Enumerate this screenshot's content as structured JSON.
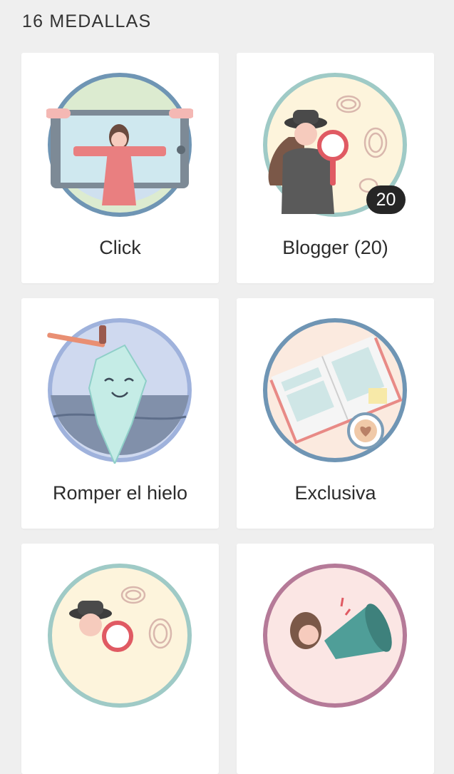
{
  "header": {
    "title": "16 MEDALLAS"
  },
  "medals": [
    {
      "label": "Click",
      "icon": "selfie-tablet-icon"
    },
    {
      "label": "Blogger (20)",
      "icon": "detective-magnifier-icon",
      "count": "20"
    },
    {
      "label": "Romper el hielo",
      "icon": "iceberg-hammer-icon"
    },
    {
      "label": "Exclusiva",
      "icon": "open-magazine-coffee-icon"
    },
    {
      "label": "",
      "icon": "detective-magnifier-icon"
    },
    {
      "label": "",
      "icon": "megaphone-icon"
    }
  ]
}
